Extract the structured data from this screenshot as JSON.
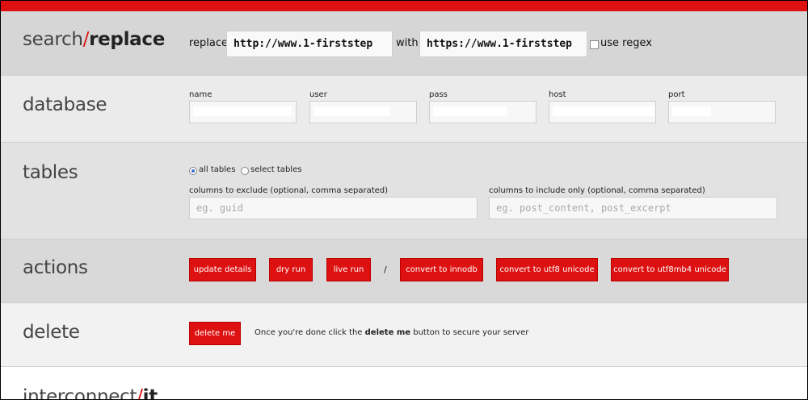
{
  "colors": {
    "accent": "#dd1111",
    "search_bg": "#d6d6d6",
    "db_bg": "#ebebeb"
  },
  "search": {
    "title_plain": "search",
    "title_slash": "/",
    "title_bold": "replace",
    "replace_label": "replace",
    "replace_value": "http://www.1-firststep",
    "with_label": "with",
    "with_value": "https://www.1-firststep",
    "regex_label": "use regex"
  },
  "database": {
    "title": "database",
    "fields": [
      {
        "label": "name"
      },
      {
        "label": "user"
      },
      {
        "label": "pass"
      },
      {
        "label": "host"
      },
      {
        "label": "port"
      }
    ]
  },
  "tables": {
    "title": "tables",
    "radio_all": "all tables",
    "radio_select": "select tables",
    "exclude_label": "columns to exclude (optional, comma separated)",
    "exclude_placeholder": "eg. guid",
    "include_label": "columns to include only (optional, comma separated)",
    "include_placeholder": "eg. post_content, post_excerpt"
  },
  "actions": {
    "title": "actions",
    "update": "update details",
    "dry_run": "dry run",
    "live_run": "live run",
    "separator": "/",
    "innodb": "convert to innodb",
    "utf8": "convert to utf8 unicode",
    "utf8mb4": "convert to utf8mb4 unicode"
  },
  "delete": {
    "title": "delete",
    "button": "delete me",
    "msg_before": "Once you're done click the ",
    "msg_bold": "delete me",
    "msg_after": " button to secure your server"
  },
  "brand": {
    "plain": "interconnect",
    "slash": "/",
    "bold": "it"
  }
}
